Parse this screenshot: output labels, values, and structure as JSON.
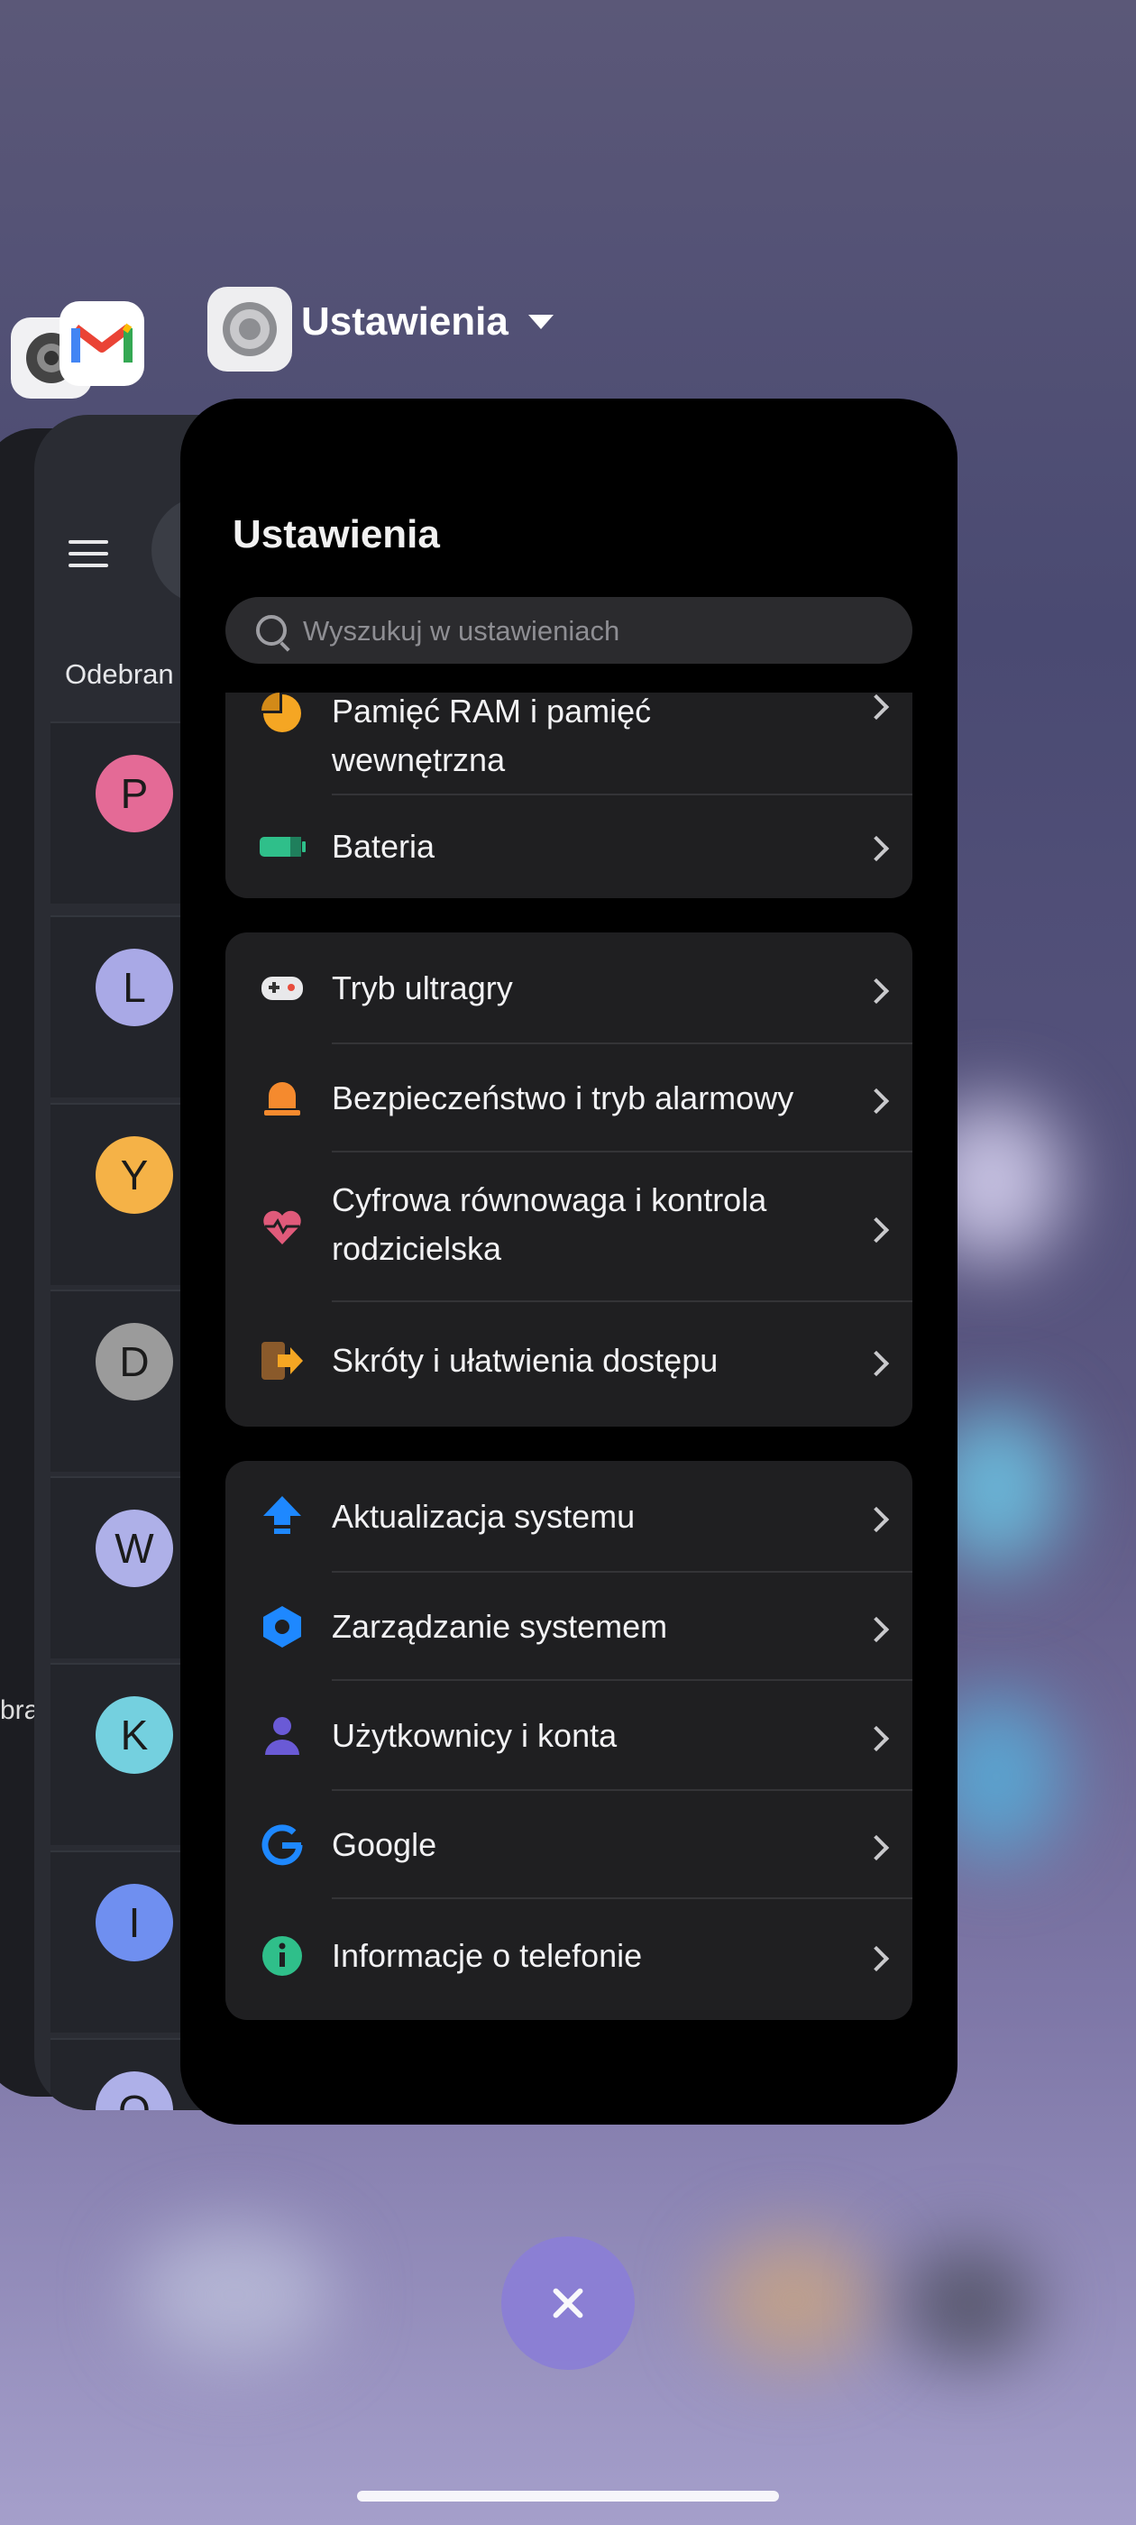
{
  "recents": {
    "app_title": "Ustawienia",
    "close_label": "×"
  },
  "gmail_card": {
    "section_label": "Odebran",
    "side_label": "bra",
    "avatars": [
      "P",
      "L",
      "Y",
      "D",
      "W",
      "K",
      "I",
      "O"
    ]
  },
  "settings": {
    "title": "Ustawienia",
    "search_placeholder": "Wyszukuj w ustawieniach",
    "group1": [
      {
        "label": "Pamięć RAM i pamięć\nwewnętrzna",
        "icon": "storage-icon"
      },
      {
        "label": "Bateria",
        "icon": "battery-icon"
      }
    ],
    "group2": [
      {
        "label": "Tryb ultragry",
        "icon": "gamepad-icon"
      },
      {
        "label": "Bezpieczeństwo i tryb alarmowy",
        "icon": "alarm-icon"
      },
      {
        "label": "Cyfrowa równowaga i kontrola rodzicielska",
        "icon": "heart-icon"
      },
      {
        "label": "Skróty i ułatwienia dostępu",
        "icon": "shortcut-icon"
      }
    ],
    "group3": [
      {
        "label": "Aktualizacja systemu",
        "icon": "update-arrow-icon"
      },
      {
        "label": "Zarządzanie systemem",
        "icon": "hexagon-icon"
      },
      {
        "label": "Użytkownicy i konta",
        "icon": "user-icon"
      },
      {
        "label": "Google",
        "icon": "google-icon"
      },
      {
        "label": "Informacje o telefonie",
        "icon": "info-icon"
      }
    ]
  },
  "colors": {
    "accent_blue": "#1e88ff",
    "avatar_p": "#e46a96",
    "avatar_l": "#a9a9e6",
    "avatar_y": "#f5b247",
    "avatar_d": "#9b9b9b",
    "avatar_w": "#aeb0e8",
    "avatar_k": "#74d0df",
    "avatar_i": "#6f8ff0"
  }
}
